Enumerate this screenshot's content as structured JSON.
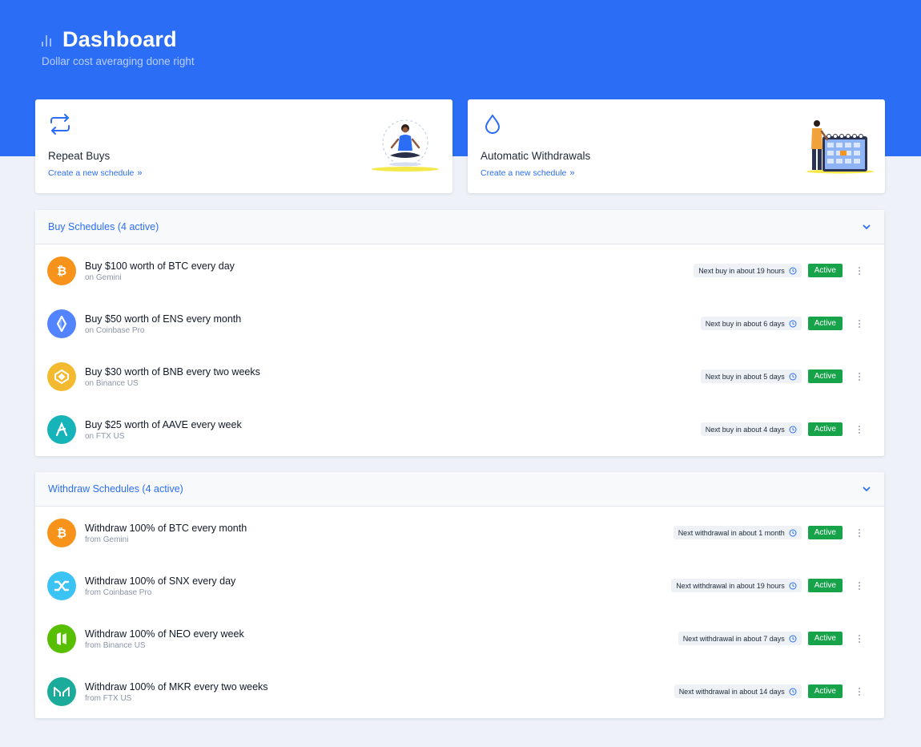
{
  "header": {
    "title": "Dashboard",
    "subtitle": "Dollar cost averaging done right"
  },
  "cards": {
    "repeat": {
      "title": "Repeat Buys",
      "link": "Create a new schedule"
    },
    "withdraw": {
      "title": "Automatic Withdrawals",
      "link": "Create a new schedule"
    }
  },
  "buy_panel": {
    "title": "Buy Schedules (4 active)",
    "rows": [
      {
        "title": "Buy $100 worth of BTC every day",
        "sub": "on Gemini",
        "next": "Next buy in about 19 hours",
        "status": "Active",
        "icon": "btc-icon",
        "color": "#f7931a"
      },
      {
        "title": "Buy $50 worth of ENS every month",
        "sub": "on Coinbase Pro",
        "next": "Next buy in about 6 days",
        "status": "Active",
        "icon": "ens-icon",
        "color": "#5284ff"
      },
      {
        "title": "Buy $30 worth of BNB every two weeks",
        "sub": "on Binance US",
        "next": "Next buy in about 5 days",
        "status": "Active",
        "icon": "bnb-icon",
        "color": "#f3ba2f"
      },
      {
        "title": "Buy $25 worth of AAVE every week",
        "sub": "on FTX US",
        "next": "Next buy in about 4 days",
        "status": "Active",
        "icon": "aave-icon",
        "color": "#16b3b8"
      }
    ]
  },
  "withdraw_panel": {
    "title": "Withdraw Schedules (4 active)",
    "rows": [
      {
        "title": "Withdraw 100% of BTC every month",
        "sub": "from Gemini",
        "next": "Next withdrawal in about 1 month",
        "status": "Active",
        "icon": "btc-icon",
        "color": "#f7931a"
      },
      {
        "title": "Withdraw 100% of SNX every day",
        "sub": "from Coinbase Pro",
        "next": "Next withdrawal in about 19 hours",
        "status": "Active",
        "icon": "snx-icon",
        "color": "#3bc3f4"
      },
      {
        "title": "Withdraw 100% of NEO every week",
        "sub": "from Binance US",
        "next": "Next withdrawal in about 7 days",
        "status": "Active",
        "icon": "neo-icon",
        "color": "#58bf00"
      },
      {
        "title": "Withdraw 100% of MKR every two weeks",
        "sub": "from FTX US",
        "next": "Next withdrawal in about 14 days",
        "status": "Active",
        "icon": "mkr-icon",
        "color": "#1aab9b"
      }
    ]
  },
  "colors": {
    "primary": "#2b6ef5",
    "active": "#16a34a",
    "background": "#eef2f8"
  }
}
